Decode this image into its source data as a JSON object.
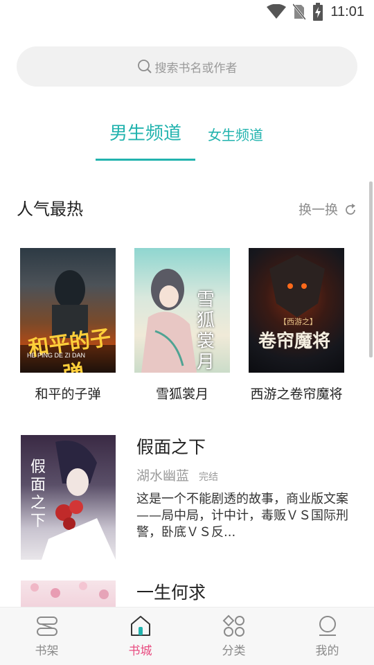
{
  "status_bar": {
    "time": "11:01"
  },
  "search": {
    "placeholder": "搜索书名或作者"
  },
  "channel_tabs": {
    "male": "男生频道",
    "female": "女生频道"
  },
  "hot_section": {
    "title": "人气最热",
    "refresh_label": "换一换",
    "books": [
      {
        "title": "和平的子弹",
        "cover_text": "和平的子弹",
        "cover_sub": "HE PING DE ZI DAN"
      },
      {
        "title": "雪狐裳月",
        "cover_text": "雪狐裳月"
      },
      {
        "title": "西游之卷帘魔将",
        "cover_text": "卷帘魔将",
        "cover_sub": "【西游之】"
      }
    ]
  },
  "list_books": [
    {
      "title": "假面之下",
      "author": "湖水幽蓝",
      "status": "完结",
      "description": "这是一个不能剧透的故事，商业版文案——局中局，计中计，毒贩ＶＳ国际刑警，卧底ＶＳ反...",
      "cover_text": "假面之下"
    },
    {
      "title": "一生何求",
      "author": "",
      "status": "",
      "description": ""
    }
  ],
  "bottom_nav": [
    {
      "label": "书架",
      "icon": "bookshelf-icon",
      "active": false
    },
    {
      "label": "书城",
      "icon": "bookstore-icon",
      "active": true
    },
    {
      "label": "分类",
      "icon": "category-icon",
      "active": false
    },
    {
      "label": "我的",
      "icon": "profile-icon",
      "active": false
    }
  ],
  "colors": {
    "accent": "#22b3ae",
    "nav_active": "#e84a7f"
  }
}
